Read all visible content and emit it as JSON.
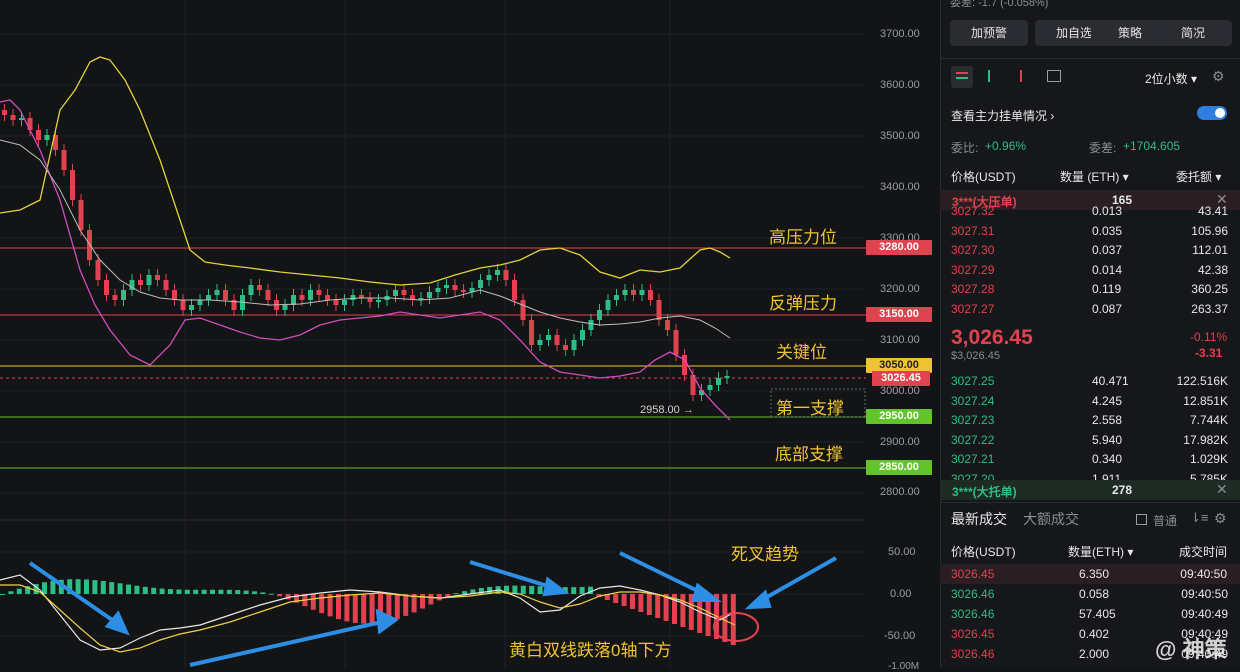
{
  "chart": {
    "y_ticks": [
      "3700.00",
      "3600.00",
      "3500.00",
      "3400.00",
      "3300.00",
      "3200.00",
      "3100.00",
      "3000.00",
      "2900.00",
      "2800.00"
    ],
    "macd_ticks": [
      "50.00",
      "0.00",
      "-50.00",
      "-1.00M"
    ],
    "levels": [
      {
        "label": "高压力位",
        "price": "3280.00",
        "color": "#e0434f",
        "text_color": "#ffffff"
      },
      {
        "label": "反弹压力",
        "price": "3150.00",
        "color": "#e0434f",
        "text_color": "#ffffff"
      },
      {
        "label": "关键位",
        "price": "3050.00",
        "color": "#f0c330",
        "text_color": "#222222"
      },
      {
        "label": "第一支撑",
        "price": "2950.00",
        "color": "#62c42a",
        "text_color": "#ffffff"
      },
      {
        "label": "底部支撑",
        "price": "2850.00",
        "color": "#62c42a",
        "text_color": "#ffffff"
      }
    ],
    "current_price_tag": "3026.45",
    "low_marker": "2958.00",
    "macd_annotations": {
      "death_cross": "死叉趋势",
      "zero_axis": "黄白双线跌落0轴下方"
    }
  },
  "panel": {
    "top_partial": "委差: -1.7 (-0.058%)",
    "buttons": [
      "加预警",
      "加自选",
      "策略",
      "简况"
    ],
    "decimals": "2位小数",
    "view_main_orders": "查看主力挂单情况",
    "wei_bi_label": "委比:",
    "wei_bi_value": "+0.96%",
    "wei_cha_label": "委差:",
    "wei_cha_value": "+1704.605",
    "headers": {
      "price": "价格(USDT)",
      "qty": "数量 (ETH)",
      "amount": "委托额"
    },
    "ask_big": {
      "label": "3***(大压单)",
      "qty": "165"
    },
    "asks": [
      {
        "p": "3027.32",
        "q": "0.013",
        "a": "43.41"
      },
      {
        "p": "3027.31",
        "q": "0.035",
        "a": "105.96"
      },
      {
        "p": "3027.30",
        "q": "0.037",
        "a": "112.01"
      },
      {
        "p": "3027.29",
        "q": "0.014",
        "a": "42.38"
      },
      {
        "p": "3027.28",
        "q": "0.119",
        "a": "360.25"
      },
      {
        "p": "3027.27",
        "q": "0.087",
        "a": "263.37"
      }
    ],
    "last_price": "3,026.45",
    "last_price_usd": "$3,026.45",
    "change_pct": "-0.11%",
    "change_abs": "-3.31",
    "bids": [
      {
        "p": "3027.25",
        "q": "40.471",
        "a": "122.516K"
      },
      {
        "p": "3027.24",
        "q": "4.245",
        "a": "12.851K"
      },
      {
        "p": "3027.23",
        "q": "2.558",
        "a": "7.744K"
      },
      {
        "p": "3027.22",
        "q": "5.940",
        "a": "17.982K"
      },
      {
        "p": "3027.21",
        "q": "0.340",
        "a": "1.029K"
      },
      {
        "p": "3027.20",
        "q": "1.911",
        "a": "5.785K"
      }
    ],
    "bid_big": {
      "label": "3***(大托单)",
      "qty": "278"
    },
    "trades_tab": "最新成交",
    "big_trades_tab": "大额成交",
    "normal_label": "普通",
    "trade_headers": {
      "price": "价格(USDT)",
      "qty": "数量(ETH)",
      "time": "成交时间"
    },
    "trades": [
      {
        "p": "3026.45",
        "q": "6.350",
        "t": "09:40:50",
        "side": "sell"
      },
      {
        "p": "3026.46",
        "q": "0.058",
        "t": "09:40:50",
        "side": "buy"
      },
      {
        "p": "3026.46",
        "q": "57.405",
        "t": "09:40:49",
        "side": "buy"
      },
      {
        "p": "3026.45",
        "q": "0.402",
        "t": "09:40:49",
        "side": "sell"
      },
      {
        "p": "3026.46",
        "q": "2.000",
        "t": "09:40:49",
        "side": "sell"
      }
    ],
    "watermark": "@ 神策"
  }
}
